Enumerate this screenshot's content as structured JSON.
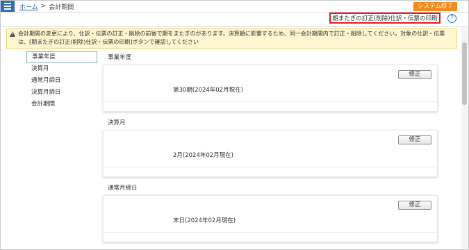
{
  "header": {
    "menu_icon": "hamburger-icon",
    "breadcrumb": {
      "home": "ホーム",
      "separator": ">",
      "current": "会計期間"
    },
    "system_exit": "システム終了"
  },
  "toolbar": {
    "print_link": "期またぎの訂正(削除)仕訳・伝票の印刷",
    "help_icon": "?"
  },
  "warning": {
    "icon": "warning-icon",
    "text": "会計期間の変更により、仕訳・伝票の訂正・削除の前後で期をまたぎのがあります。決算額に影響するため、同一会計期間内で訂正・削除してください。対象の仕訳・伝票は、[期またぎの訂正(削除)仕訳・伝票の印刷]ボタンで確認してください"
  },
  "sidebar": {
    "items": [
      "事業年度",
      "決算月",
      "通常月締日",
      "決算月締日",
      "会計期間"
    ],
    "active_index": 0
  },
  "sections": [
    {
      "title": "事業年度",
      "value": "第30期(2024年02月現在)",
      "edit_label": "修正"
    },
    {
      "title": "決算月",
      "value": "2月(2024年02月現在)",
      "edit_label": "修正"
    },
    {
      "title": "通常月締日",
      "value": "末日(2024年02月現在)",
      "edit_label": "修正"
    }
  ],
  "colors": {
    "accent_blue": "#2f6fba",
    "exit_orange": "#f28a1d",
    "highlight_red": "#e0191d",
    "warning_bg": "#fff7d1"
  }
}
